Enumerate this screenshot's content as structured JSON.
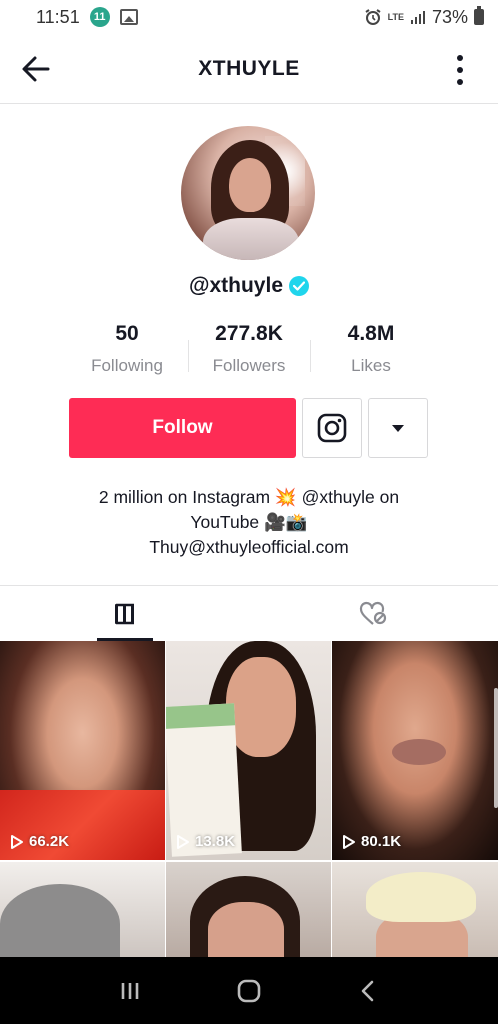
{
  "status_bar": {
    "time": "11:51",
    "app_badge": "11",
    "network": "LTE",
    "battery": "73%"
  },
  "header": {
    "title": "XTHUYLE"
  },
  "profile": {
    "username": "@xthuyle",
    "verified": true,
    "stats": [
      {
        "value": "50",
        "label": "Following"
      },
      {
        "value": "277.8K",
        "label": "Followers"
      },
      {
        "value": "4.8M",
        "label": "Likes"
      }
    ],
    "follow_label": "Follow",
    "bio_line1": "2 million on Instagram 💥 @xthuyle on",
    "bio_line2": "YouTube 🎥📸",
    "bio_line3": "Thuy@xthuyleofficial.com"
  },
  "tabs": [
    {
      "name": "videos-tab",
      "icon": "grid-icon",
      "active": true
    },
    {
      "name": "liked-tab",
      "icon": "liked-heart-icon",
      "active": false
    }
  ],
  "videos": [
    {
      "views": "66.2K"
    },
    {
      "views": "13.8K"
    },
    {
      "views": "80.1K"
    },
    {
      "views": ""
    },
    {
      "views": ""
    },
    {
      "views": ""
    }
  ],
  "colors": {
    "accent": "#fe2c55",
    "verified": "#20d5ec",
    "text": "#161823",
    "muted": "#8a8b91"
  }
}
